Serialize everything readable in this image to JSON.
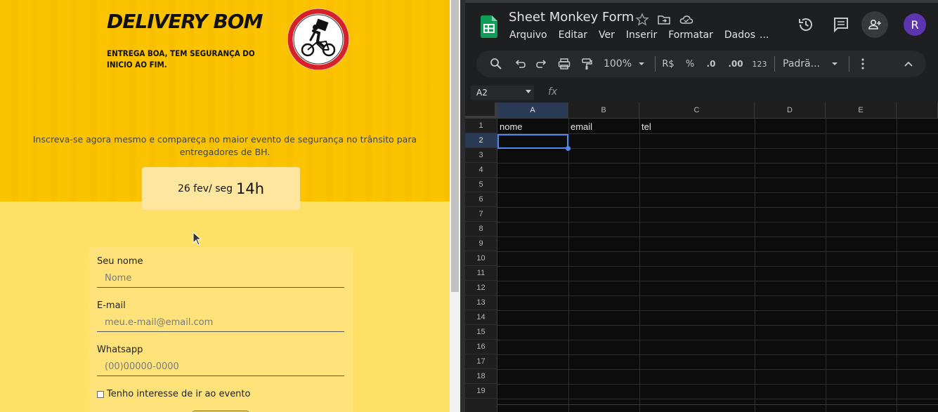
{
  "landing": {
    "title": "DELIVERY BOM",
    "tagline": "ENTREGA BOA, TEM SEGURANÇA DO INICIO AO FIM.",
    "description": "Inscreva-se agora mesmo e compareça no maior evento de segurança no trânsito para entregadores de BH.",
    "date_small": "26 fev/ seg",
    "date_big": "14h",
    "form": {
      "name_label": "Seu nome",
      "name_placeholder": "Nome",
      "email_label": "E-mail",
      "email_placeholder": "meu.e-mail@email.com",
      "whatsapp_label": "Whatsapp",
      "whatsapp_placeholder": "(00)00000-0000",
      "checkbox_label": "Tenho interesse de ir ao evento"
    },
    "colors": {
      "hero": "#fcc400",
      "body": "#ffe066",
      "logo_ring": "#d6202a"
    }
  },
  "sheets": {
    "doc_title": "Sheet Monkey Form",
    "menus": [
      "Arquivo",
      "Editar",
      "Ver",
      "Inserir",
      "Formatar",
      "Dados",
      "..."
    ],
    "avatar_letter": "R",
    "toolbar": {
      "zoom": "100%",
      "currency": "R$",
      "percent": "%",
      "decrease_decimal": ".0",
      "increase_decimal": ".00",
      "number_format": "123",
      "font": "Padrã..."
    },
    "namebox": "A2",
    "fx_label": "fx",
    "columns": [
      "A",
      "B",
      "C",
      "D",
      "E"
    ],
    "rows": [
      "1",
      "2",
      "3",
      "4",
      "5",
      "6",
      "7",
      "8",
      "9",
      "10",
      "11",
      "12",
      "13",
      "14",
      "15",
      "16",
      "17",
      "18",
      "19"
    ],
    "cells": {
      "A1": "nome",
      "B1": "email",
      "C1": "tel"
    },
    "selected_cell": "A2",
    "colors": {
      "accent": "#4d8af0",
      "avatar": "#5e35b1",
      "sheets_green": "#0f9d58"
    }
  }
}
